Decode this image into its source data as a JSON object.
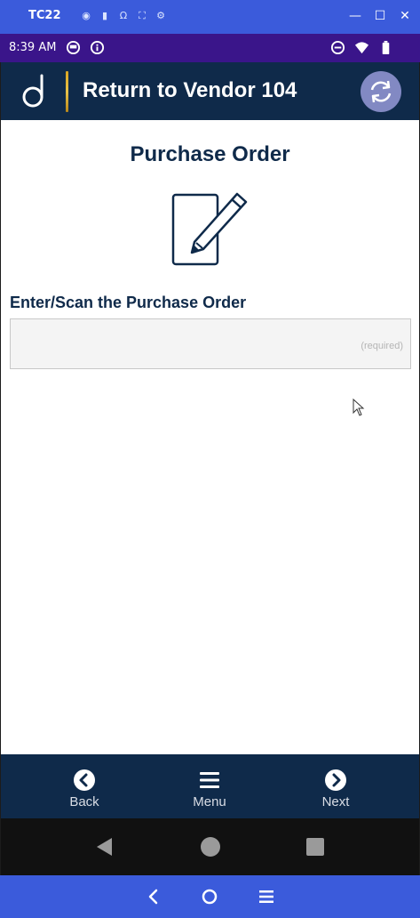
{
  "window": {
    "title": "TC22",
    "tool_icons": [
      "camera-icon",
      "video-icon",
      "headset-icon",
      "fullscreen-icon",
      "settings-icon"
    ],
    "controls": [
      "minimize-icon",
      "maximize-icon",
      "close-icon"
    ]
  },
  "status_bar": {
    "time": "8:39 AM"
  },
  "header": {
    "title": "Return to Vendor 104",
    "refresh_icon": "refresh-icon",
    "accent_color": "#0f2a4a"
  },
  "main": {
    "page_title": "Purchase Order",
    "field_label": "Enter/Scan the Purchase Order",
    "field_value": "",
    "field_placeholder": "(required)"
  },
  "bottom_nav": {
    "back_label": "Back",
    "menu_label": "Menu",
    "next_label": "Next"
  },
  "android_nav": [
    "back-triangle-icon",
    "home-circle-icon",
    "recents-square-icon"
  ],
  "emulator_nav": [
    "chevron-left-icon",
    "circle-icon",
    "hamburger-icon"
  ]
}
